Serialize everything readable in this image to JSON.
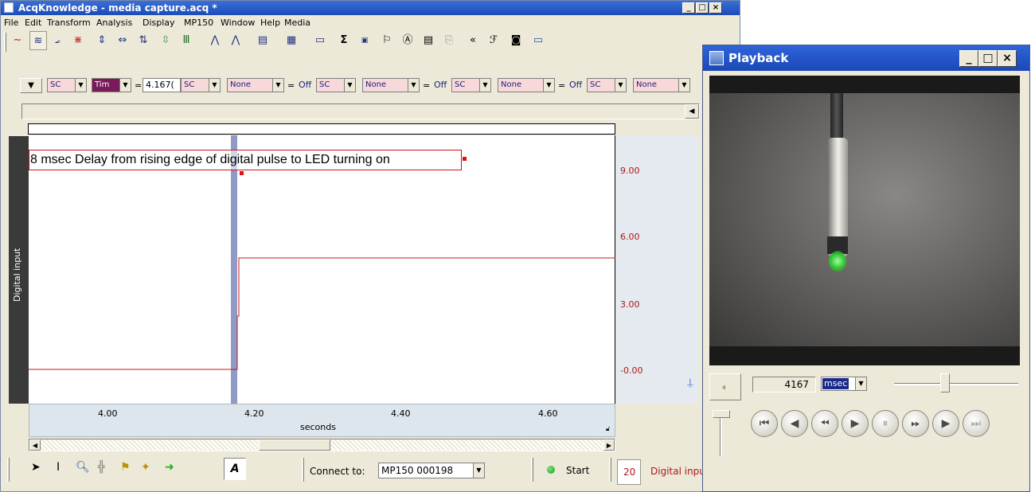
{
  "main_window": {
    "title": "AcqKnowledge - media capture.acq *",
    "menu": [
      "File",
      "Edit",
      "Transform",
      "Analysis",
      "Display",
      "MP150",
      "Window",
      "Help",
      "Media"
    ],
    "measurements": [
      {
        "channel": "SC",
        "type": "Tim",
        "value": "4.167("
      },
      {
        "channel": "SC",
        "type": "None",
        "value": "Off"
      },
      {
        "channel": "SC",
        "type": "None",
        "value": "Off"
      },
      {
        "channel": "SC",
        "type": "None",
        "value": "Off"
      },
      {
        "channel": "SC",
        "type": "None",
        "value": ""
      }
    ],
    "equals": "=",
    "annotation": "8 msec Delay from rising edge of digital pulse to LED turning on",
    "channel_label": "Digital input",
    "y_ticks": [
      "9.00",
      "6.00",
      "3.00",
      "-0.00"
    ],
    "x_ticks": [
      "4.00",
      "4.20",
      "4.40",
      "4.60"
    ],
    "x_axis_label": "seconds",
    "connect_label": "Connect to:",
    "connect_value": "MP150 000198",
    "start_label": "Start",
    "channel_number": "20",
    "channel_name": "Digital input",
    "trace_color": "#cc1414",
    "cursor_color": "#8f9ac6"
  },
  "playback_window": {
    "title": "Playback",
    "time_value": "4167",
    "unit": "msec"
  },
  "icons": {
    "toolbar": [
      "wave-icon",
      "overlap-icon",
      "stack-icon",
      "scatter-icon",
      "autoscale-icon",
      "horizontal-icon",
      "vertical-icon",
      "adjust-icon",
      "grid-icon",
      "peak-icon",
      "multipeak-icon",
      "print-icon",
      "grid-toggle-icon",
      "link-icon",
      "sigma-icon",
      "counter-icon",
      "flag-icon",
      "text-icon",
      "journal-icon",
      "copy-icon",
      "rewind-icon",
      "wave-tool-icon",
      "camera-icon",
      "monitor-icon"
    ],
    "bottom_tools": [
      "arrow-tool-icon",
      "ibeam-tool-icon",
      "zoom-tool-icon",
      "crosshair-tool-icon",
      "flag-tool-icon",
      "marker-tool-icon",
      "next-tool-icon",
      "annotate-tool-icon"
    ],
    "playback": [
      "first-frame-icon",
      "step-back-icon",
      "rewind-icon",
      "play-icon",
      "pause-icon",
      "fast-forward-icon",
      "step-forward-icon",
      "last-frame-icon"
    ]
  }
}
